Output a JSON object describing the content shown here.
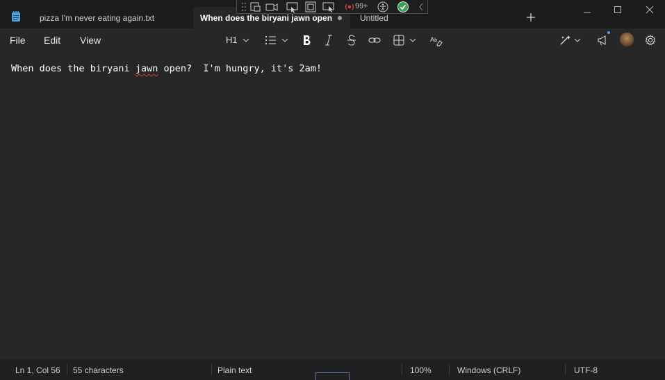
{
  "tabs": [
    {
      "label": "pizza I'm never eating again.txt",
      "active": false
    },
    {
      "label": "When does the biryani jawn open",
      "active": true
    },
    {
      "label": "Untitled",
      "active": false
    }
  ],
  "floating_toolbar": {
    "notification_count": "99+"
  },
  "menu": {
    "file": "File",
    "edit": "Edit",
    "view": "View"
  },
  "format": {
    "heading": "H1"
  },
  "editor": {
    "before": "When does the biryani ",
    "misspelled": "jawn",
    "after": " open?  I'm hungry, it's 2am!"
  },
  "status": {
    "position": "Ln 1, Col 56",
    "characters": "55 characters",
    "format": "Plain text",
    "zoom": "100%",
    "line_ending": "Windows (CRLF)",
    "encoding": "UTF-8"
  },
  "colors": {
    "titlebar_bg": "#1c1c1c",
    "editor_bg": "#272727",
    "statusbar_bg": "#202020",
    "app_icon": "#4fa3e0",
    "spell_error": "#e04040",
    "check_green": "#3aa05a"
  }
}
